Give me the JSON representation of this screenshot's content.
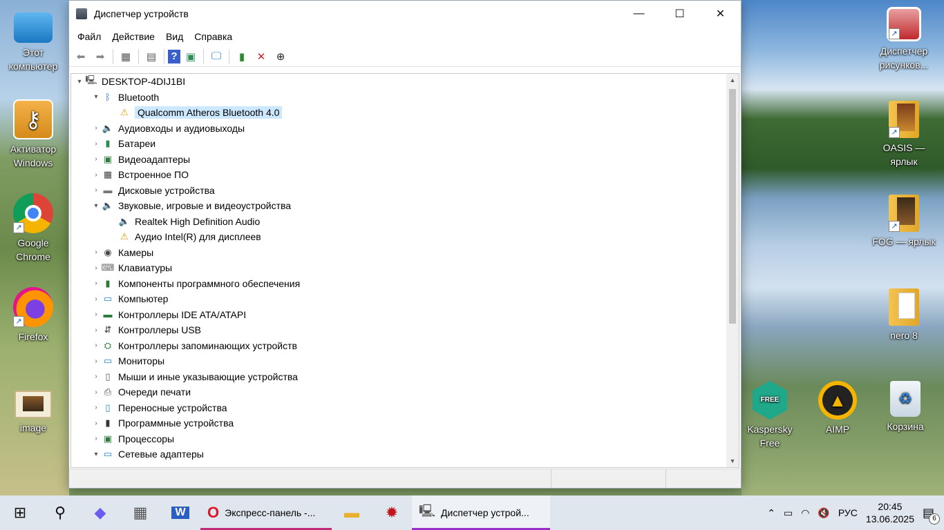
{
  "desktop": {
    "left_icons": [
      {
        "label": "Этот компьютер",
        "icon": "this-pc-icon"
      },
      {
        "label": "Активатор Windows",
        "icon": "key-icon"
      },
      {
        "label": "Google Chrome",
        "icon": "chrome-icon"
      },
      {
        "label": "Firefox",
        "icon": "firefox-icon"
      },
      {
        "label": "image",
        "icon": "image-icon"
      }
    ],
    "right_icons": [
      {
        "label": "Диспетчер рисунков...",
        "icon": "picture-manager-icon"
      },
      {
        "label": "OASIS — ярлык",
        "icon": "folder-icon"
      },
      {
        "label": "FOG — ярлык",
        "icon": "folder-icon"
      },
      {
        "label": "nero 8",
        "icon": "folder-icon"
      }
    ],
    "bottom_icons": [
      {
        "label": "Kaspersky Free",
        "icon": "kaspersky-icon"
      },
      {
        "label": "AIMP",
        "icon": "aimp-icon"
      },
      {
        "label": "Корзина",
        "icon": "recycle-bin-icon"
      }
    ]
  },
  "window": {
    "title": "Диспетчер устройств",
    "controls": {
      "minimize": "—",
      "maximize": "☐",
      "close": "✕"
    },
    "menu": [
      "Файл",
      "Действие",
      "Вид",
      "Справка"
    ]
  },
  "tree": {
    "root": "DESKTOP-4DIJ1BI",
    "items": [
      {
        "label": "Bluetooth",
        "level": 1,
        "expanded": true
      },
      {
        "label": "Qualcomm Atheros Bluetooth 4.0",
        "level": 2,
        "warning": true,
        "selected": true
      },
      {
        "label": "Аудиовходы и аудиовыходы",
        "level": 1,
        "expanded": false
      },
      {
        "label": "Батареи",
        "level": 1,
        "expanded": false
      },
      {
        "label": "Видеоадаптеры",
        "level": 1,
        "expanded": false
      },
      {
        "label": "Встроенное ПО",
        "level": 1,
        "expanded": false
      },
      {
        "label": "Дисковые устройства",
        "level": 1,
        "expanded": false
      },
      {
        "label": "Звуковые, игровые и видеоустройства",
        "level": 1,
        "expanded": true
      },
      {
        "label": "Realtek High Definition Audio",
        "level": 2
      },
      {
        "label": "Аудио Intel(R) для дисплеев",
        "level": 2,
        "warning": true
      },
      {
        "label": "Камеры",
        "level": 1,
        "expanded": false
      },
      {
        "label": "Клавиатуры",
        "level": 1,
        "expanded": false
      },
      {
        "label": "Компоненты программного обеспечения",
        "level": 1,
        "expanded": false
      },
      {
        "label": "Компьютер",
        "level": 1,
        "expanded": false
      },
      {
        "label": "Контроллеры IDE ATA/ATAPI",
        "level": 1,
        "expanded": false
      },
      {
        "label": "Контроллеры USB",
        "level": 1,
        "expanded": false
      },
      {
        "label": "Контроллеры запоминающих устройств",
        "level": 1,
        "expanded": false
      },
      {
        "label": "Мониторы",
        "level": 1,
        "expanded": false
      },
      {
        "label": "Мыши и иные указывающие устройства",
        "level": 1,
        "expanded": false
      },
      {
        "label": "Очереди печати",
        "level": 1,
        "expanded": false
      },
      {
        "label": "Переносные устройства",
        "level": 1,
        "expanded": false
      },
      {
        "label": "Программные устройства",
        "level": 1,
        "expanded": false
      },
      {
        "label": "Процессоры",
        "level": 1,
        "expanded": false
      },
      {
        "label": "Сетевые адаптеры",
        "level": 1,
        "expanded": true
      }
    ]
  },
  "taskbar": {
    "opera_label": "Экспресс-панель -...",
    "devmgr_label": "Диспетчер устрой...",
    "language": "РУС",
    "time": "20:45",
    "date": "13.06.2025",
    "notifications_count": "6"
  }
}
